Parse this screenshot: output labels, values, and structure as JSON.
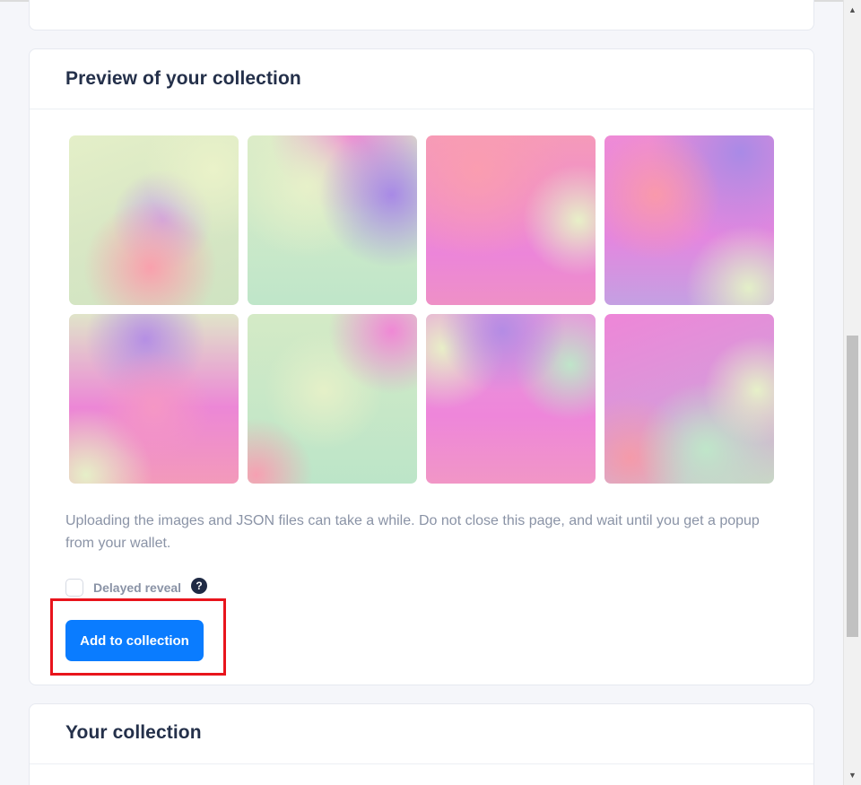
{
  "preview_section": {
    "title": "Preview of your collection",
    "tiles": [
      {
        "name": "preview-image-1"
      },
      {
        "name": "preview-image-2"
      },
      {
        "name": "preview-image-3"
      },
      {
        "name": "preview-image-4"
      },
      {
        "name": "preview-image-5"
      },
      {
        "name": "preview-image-6"
      },
      {
        "name": "preview-image-7"
      },
      {
        "name": "preview-image-8"
      }
    ],
    "upload_note": "Uploading the images and JSON files can take a while. Do not close this page, and wait until you get a popup from your wallet.",
    "delayed_reveal_label": "Delayed reveal",
    "delayed_reveal_checked": false,
    "help_icon_glyph": "?",
    "add_button_label": "Add to collection"
  },
  "your_collection_section": {
    "title": "Your collection"
  },
  "scrollbar": {
    "up_arrow": "▲",
    "down_arrow": "▼"
  },
  "colors": {
    "accent": "#0a7cff",
    "highlight_border": "#e8141c",
    "title_text": "#24304a",
    "muted_text": "#8a93a6"
  }
}
